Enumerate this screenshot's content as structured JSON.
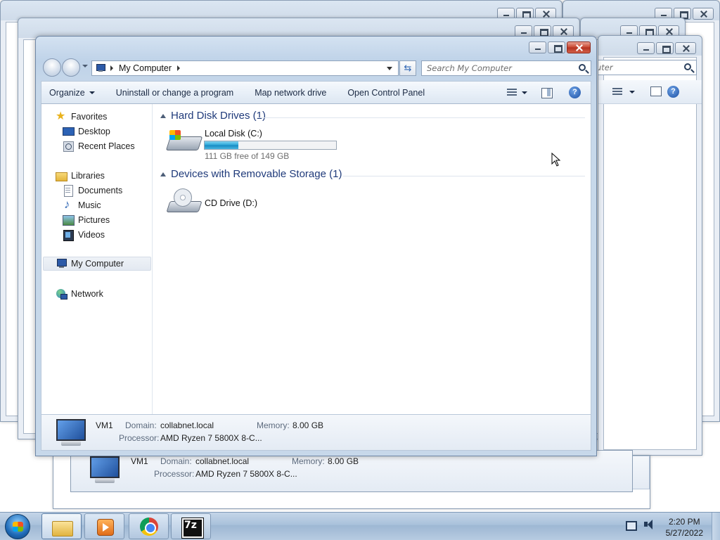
{
  "window": {
    "title": "My Computer",
    "breadcrumb": "My Computer",
    "search_placeholder": "Search My Computer"
  },
  "commands": {
    "organize": "Organize",
    "uninstall": "Uninstall or change a program",
    "map_drive": "Map network drive",
    "control_panel": "Open Control Panel"
  },
  "nav": {
    "favorites": "Favorites",
    "desktop": "Desktop",
    "recent": "Recent Places",
    "libraries": "Libraries",
    "documents": "Documents",
    "music": "Music",
    "pictures": "Pictures",
    "videos": "Videos",
    "computer": "My Computer",
    "network": "Network"
  },
  "groups": {
    "hdd": "Hard Disk Drives (1)",
    "removable": "Devices with Removable Storage (1)"
  },
  "drives": {
    "c": {
      "name": "Local Disk (C:)",
      "free": "111 GB free of 149 GB",
      "used_fraction": 0.255
    },
    "d": {
      "name": "CD Drive (D:)"
    }
  },
  "details": {
    "name": "VM1",
    "domain_label": "Domain:",
    "domain": "collabnet.local",
    "memory_label": "Memory:",
    "memory": "8.00 GB",
    "processor_label": "Processor:",
    "processor": "AMD Ryzen 7 5800X 8-C..."
  },
  "bg_windows": {
    "search_fragment": "uter",
    "details_name": "VM1",
    "domain_label": "Domain:",
    "domain": "collabnet.local",
    "memory_label": "Memory:",
    "memory": "8.00 GB",
    "processor_label": "Processor:",
    "processor": "AMD Ryzen 7 5800X 8-C..."
  },
  "taskbar": {
    "time": "2:20 PM",
    "date": "5/27/2022",
    "sevenzip_label": "7z"
  },
  "icons": [
    "star-icon",
    "desktop-icon",
    "recent-places-icon",
    "libraries-icon",
    "documents-icon",
    "music-icon",
    "pictures-icon",
    "videos-icon",
    "computer-icon",
    "network-icon",
    "hard-disk-icon",
    "cd-drive-icon",
    "search-icon",
    "help-icon"
  ]
}
